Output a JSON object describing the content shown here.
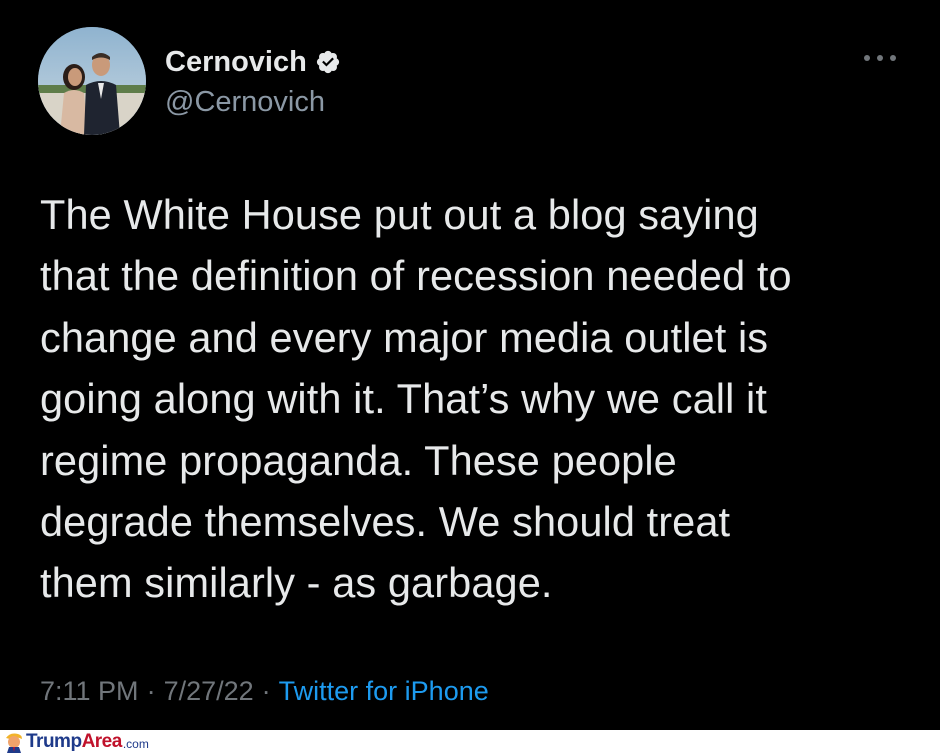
{
  "tweet": {
    "author": {
      "display_name": "Cernovich",
      "handle": "@Cernovich",
      "verified": true,
      "avatar_icon": "profile-photo-avatar"
    },
    "more_icon": "more-horizontal-icon",
    "text": "The White House put out a blog saying\nthat the definition of recession needed to\nchange and every major media outlet is\ngoing along with it. That’s why we call it\nregime propaganda. These people\ndegrade themselves. We should treat\nthem similarly - as garbage.",
    "time": "7:11 PM",
    "date": "7/27/22",
    "separator": "·",
    "source": "Twitter for iPhone",
    "colors": {
      "background": "#000000",
      "text": "#e7e9ea",
      "muted": "#71767b",
      "link": "#1d9bf0"
    }
  },
  "watermark": {
    "brand_part1": "Trump",
    "brand_part2": "Area",
    "brand_tld": ".com",
    "logo_icon": "trump-caricature-icon",
    "colors": {
      "trump": "#1e3a8a",
      "area": "#c0122b"
    }
  }
}
